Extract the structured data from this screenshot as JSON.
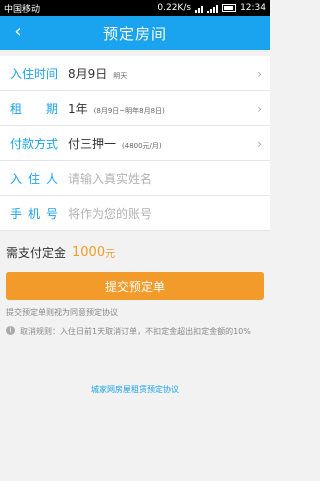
{
  "status_bar": {
    "carrier": "中国移动",
    "speed": "0.22K/s",
    "time": "12:34"
  },
  "header": {
    "back_icon": "back-arrow-icon",
    "title": "预定房间"
  },
  "form": {
    "checkin": {
      "label": "入住时间",
      "date": "8月9日",
      "note": "明天"
    },
    "term": {
      "label": "租　期",
      "value": "1年",
      "note": "(8月9日~明年8月8日)"
    },
    "payment": {
      "label": "付款方式",
      "value": "付三押一",
      "note": "(4800元/月)"
    },
    "tenant": {
      "label": "入住人",
      "placeholder": "请输入真实姓名"
    },
    "phone": {
      "label": "手机号",
      "placeholder": "将作为您的账号"
    }
  },
  "deposit": {
    "label": "需支付定金",
    "amount": "1000",
    "unit": "元"
  },
  "submit_label": "提交预定单",
  "agree_note": "提交预定单则视为同意预定协议",
  "cancel_rule": "取消规则：入住日前1天取消订单，不扣定金超出扣定金额的10%",
  "protocol_link": "城家网房屋租赁预定协议",
  "colors": {
    "primary": "#1aa3ee",
    "accent": "#f39b2a"
  }
}
